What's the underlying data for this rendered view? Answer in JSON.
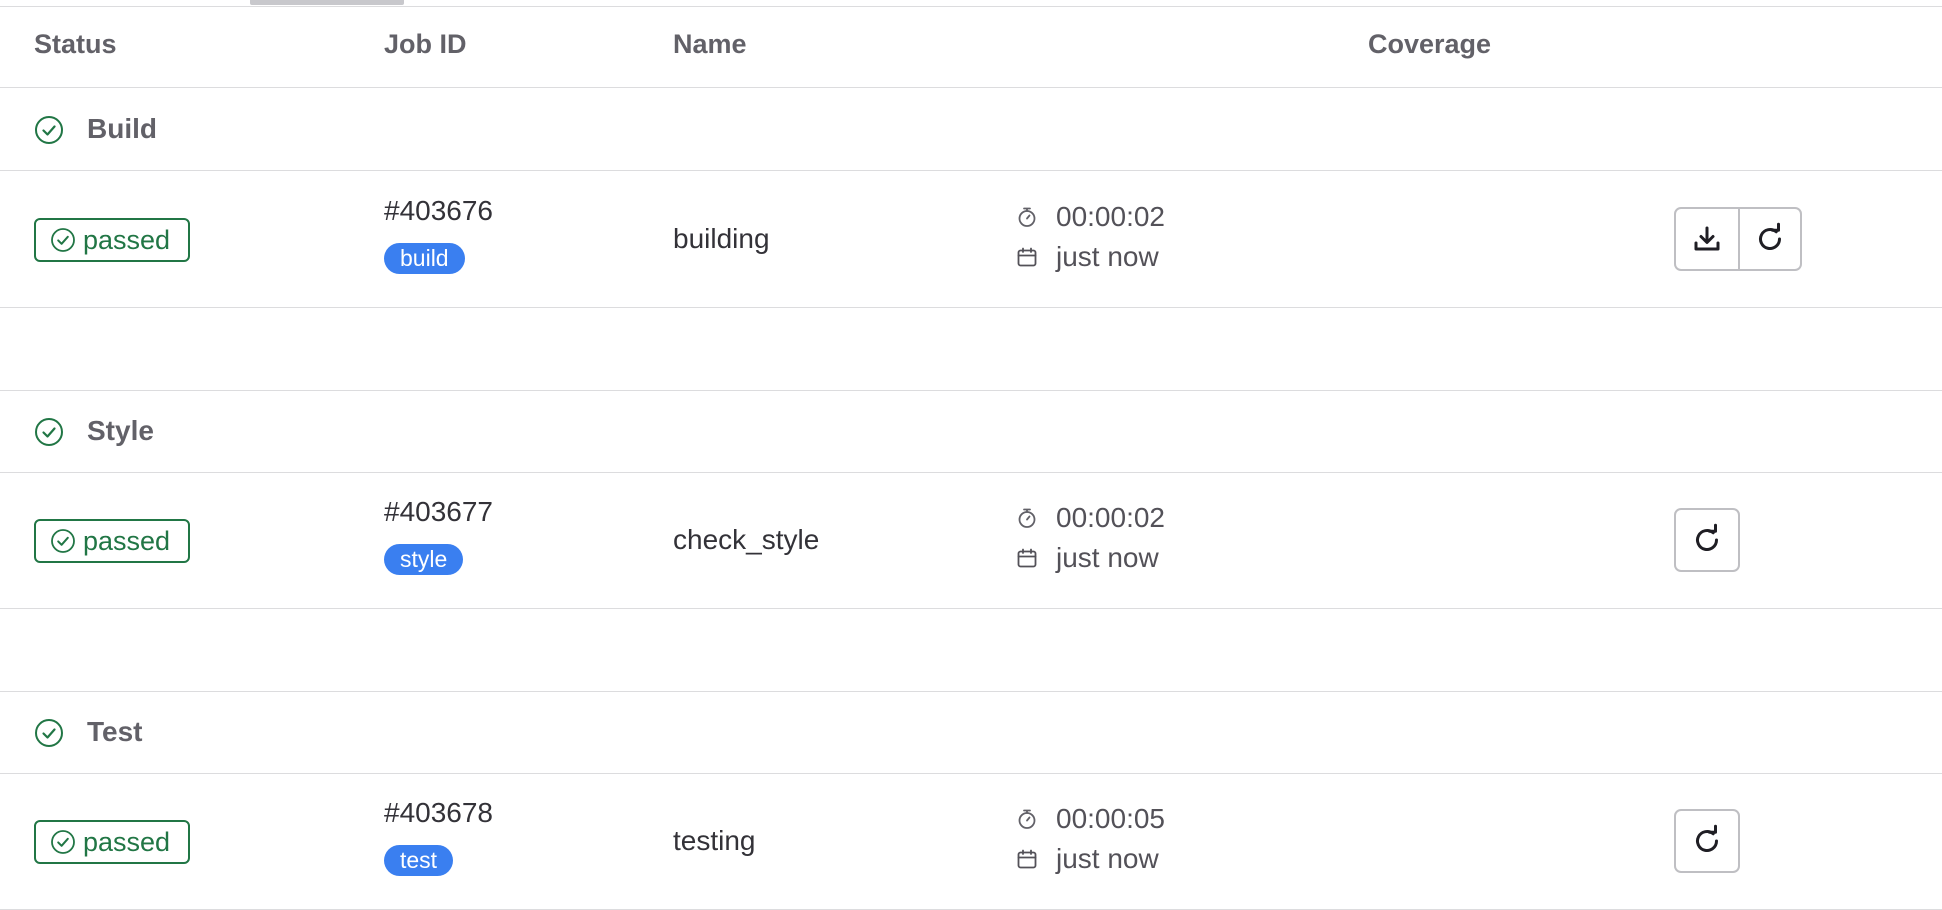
{
  "table": {
    "headers": {
      "status": "Status",
      "job_id": "Job ID",
      "name": "Name",
      "coverage": "Coverage"
    }
  },
  "stages": [
    {
      "title": "Build",
      "job": {
        "status": "passed",
        "id": "#403676",
        "stage_tag": "build",
        "name": "building",
        "duration": "00:00:02",
        "finished": "just now",
        "actions": [
          "download-artifacts",
          "retry"
        ]
      }
    },
    {
      "title": "Style",
      "job": {
        "status": "passed",
        "id": "#403677",
        "stage_tag": "style",
        "name": "check_style",
        "duration": "00:00:02",
        "finished": "just now",
        "actions": [
          "retry"
        ]
      }
    },
    {
      "title": "Test",
      "job": {
        "status": "passed",
        "id": "#403678",
        "stage_tag": "test",
        "name": "testing",
        "duration": "00:00:05",
        "finished": "just now",
        "actions": [
          "retry"
        ]
      }
    }
  ],
  "colors": {
    "success": "#217645",
    "tag": "#3a7ff0",
    "header_text": "#626168",
    "border": "#dcdcde"
  },
  "icons": {
    "stage_status": "check-circle-icon",
    "duration": "timer-icon",
    "finished": "calendar-icon",
    "download": "download-icon",
    "retry": "retry-icon"
  }
}
